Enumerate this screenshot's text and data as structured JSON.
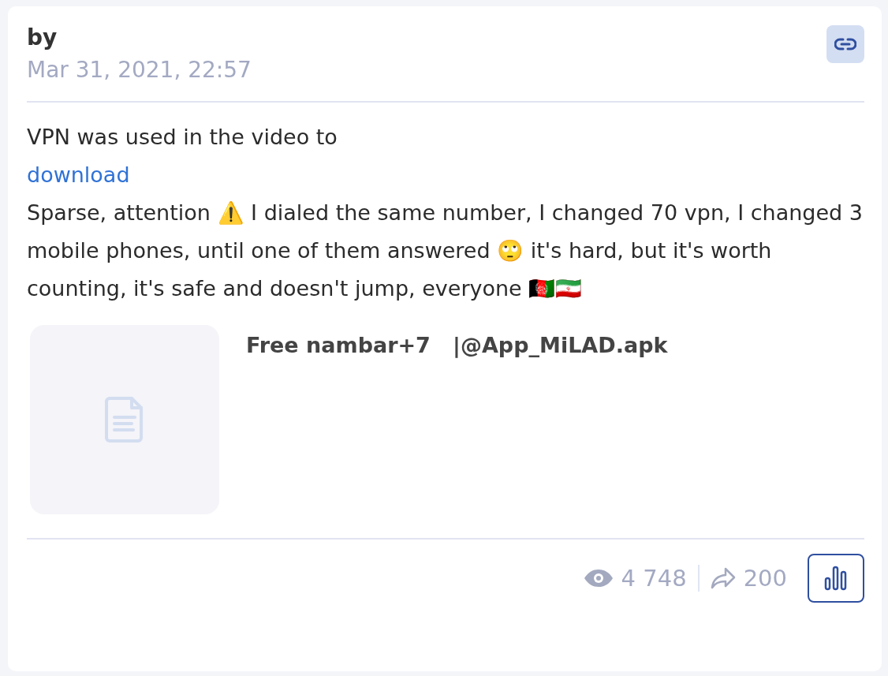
{
  "post": {
    "author_label": "by",
    "date": "Mar 31, 2021, 22:57",
    "text_lines": [
      {
        "kind": "text",
        "text": "VPN was used in the video to"
      },
      {
        "kind": "link",
        "text": "download"
      },
      {
        "kind": "text",
        "text": "Sparse, attention ⚠️ I dialed the same number, I changed 70 vpn, I changed 3 mobile phones, until one of them answered 🙄 it's hard, but it's worth counting, it's safe and doesn't jump, everyone 🇦🇫🇮🇷"
      }
    ],
    "attachment": {
      "kind": "file",
      "name": "Free nambar+7   |@App_MiLAD.apk"
    },
    "views": "4 748",
    "shares": "200"
  }
}
